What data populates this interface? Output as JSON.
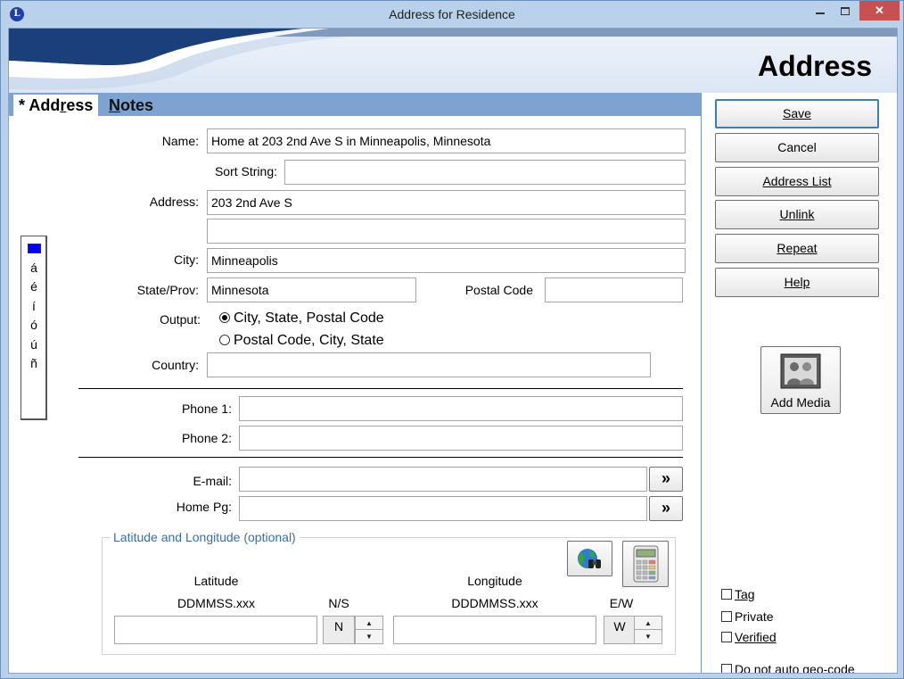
{
  "window": {
    "title": "Address for Residence",
    "app_icon_letter": "L",
    "min_glyph": "",
    "close_glyph": "✕"
  },
  "banner": {
    "title": "Address"
  },
  "tabs": [
    {
      "prefix": "* ",
      "before": "Add",
      "accel": "r",
      "after": "ess",
      "active": true
    },
    {
      "prefix": "",
      "before": "",
      "accel": "N",
      "after": "otes",
      "active": false
    }
  ],
  "accents": {
    "chars": [
      "á",
      "é",
      "í",
      "ó",
      "ú",
      "ñ"
    ],
    "swatch_color": "#0000ff"
  },
  "form": {
    "name_label": "Name:",
    "name_value": "Home at 203 2nd Ave S in Minneapolis, Minnesota",
    "sort_label": "Sort String:",
    "sort_value": "",
    "address_label": "Address:",
    "address1_value": "203 2nd Ave S",
    "address2_value": "",
    "city_label": "City:",
    "city_value": "Minneapolis",
    "state_label": "State/Prov:",
    "state_value": "Minnesota",
    "postal_label": "Postal Code",
    "postal_value": "",
    "output_label": "Output:",
    "output_options": [
      {
        "label": "City, State, Postal Code",
        "selected": true
      },
      {
        "label": "Postal Code, City, State",
        "selected": false
      }
    ],
    "country_label": "Country:",
    "country_value": "",
    "phone1_label": "Phone 1:",
    "phone1_value": "",
    "phone2_label": "Phone 2:",
    "phone2_value": "",
    "email_label": "E-mail:",
    "email_value": "",
    "homepg_label": "Home Pg:",
    "homepg_value": "",
    "go_glyph": "»"
  },
  "latlon": {
    "group_title": "Latitude and Longitude (optional)",
    "lat_label": "Latitude",
    "lat_format": "DDMMSS.xxx",
    "lat_value": "",
    "ns_label": "N/S",
    "ns_value": "N",
    "lon_label": "Longitude",
    "lon_format": "DDDMMSS.xxx",
    "lon_value": "",
    "ew_label": "E/W",
    "ew_value": "W",
    "spin_up": "▲",
    "spin_down": "▼",
    "globe_icon": "globe-binoculars-icon",
    "calc_icon": "calculator-icon"
  },
  "actions": {
    "save": "Save",
    "cancel": "Cancel",
    "address_list": "Address List",
    "unlink": "Unlink",
    "repeat": "Repeat",
    "help": "Help",
    "add_media": "Add Media"
  },
  "options": {
    "tag": "Tag",
    "private": "Private",
    "verified": "Verified",
    "no_geocode": "Do not auto geo-code"
  },
  "colors": {
    "frame": "#b9d1ea",
    "tab_strip": "#7fa3d1",
    "close_button": "#c75050",
    "group_title": "#3a6ea8",
    "default_button_border": "#3c7fb1"
  }
}
